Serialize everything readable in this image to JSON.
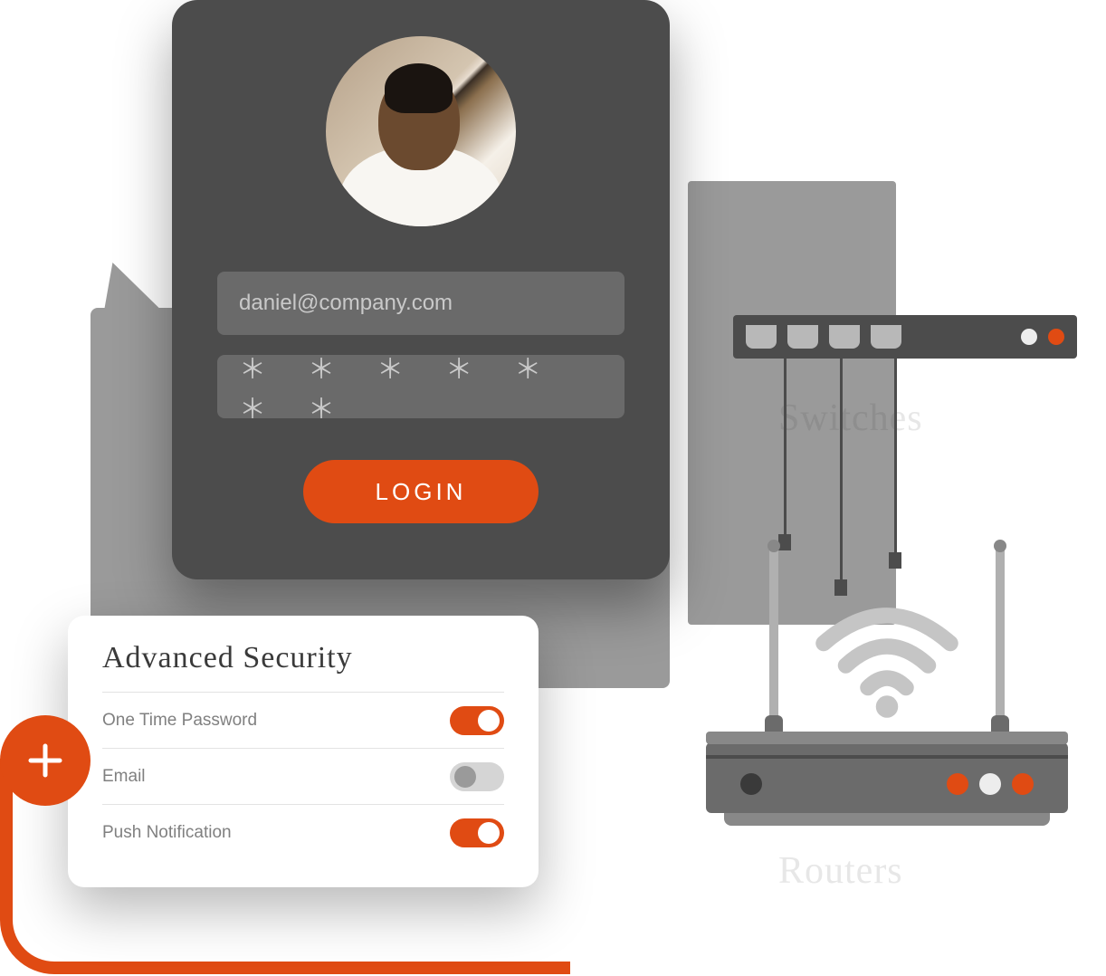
{
  "login": {
    "email_value": "daniel@company.com",
    "password_masked": "＊ ＊ ＊ ＊ ＊ ＊ ＊",
    "button_label": "LOGIN"
  },
  "security": {
    "title": "Advanced Security",
    "options": [
      {
        "label": "One Time Password",
        "enabled": true
      },
      {
        "label": "Email",
        "enabled": false
      },
      {
        "label": "Push Notification",
        "enabled": true
      }
    ]
  },
  "devices": {
    "switch_label": "Switches",
    "router_label": "Routers"
  },
  "colors": {
    "accent": "#e04b13",
    "card_dark": "#4c4c4c",
    "input_bg": "#6a6a6a"
  }
}
